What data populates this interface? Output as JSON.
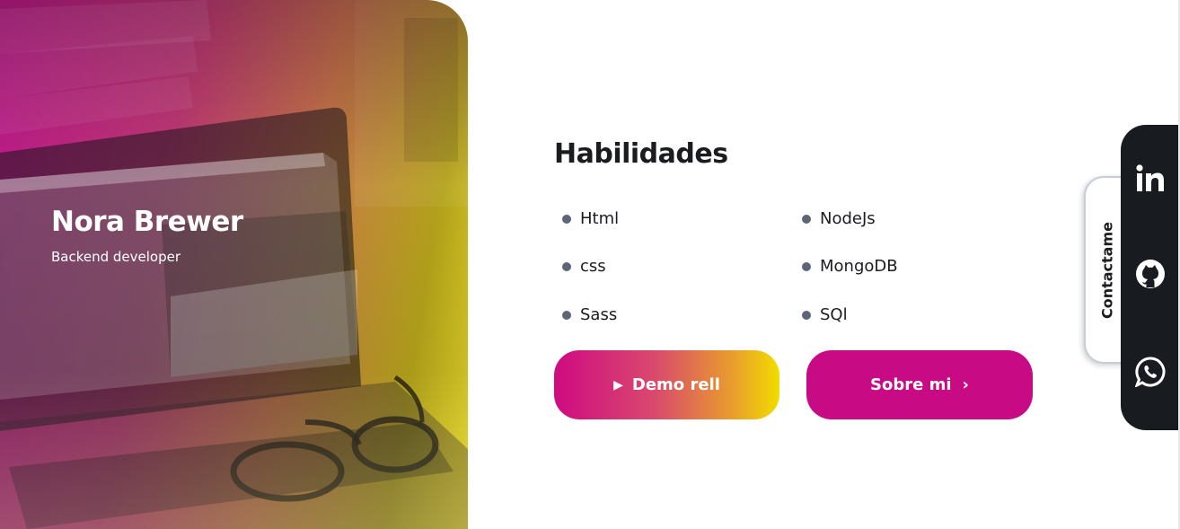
{
  "hero": {
    "name": "Nora Brewer",
    "role": "Backend developer"
  },
  "skills": {
    "title": "Habilidades",
    "left": [
      "Html",
      "css",
      "Sass"
    ],
    "right": [
      "NodeJs",
      "MongoDB",
      "SQl"
    ]
  },
  "buttons": {
    "demo_label": "Demo rell",
    "about_label": "Sobre mi"
  },
  "contact": {
    "tab_label": "Contactame",
    "icons": [
      "linkedin-icon",
      "github-icon",
      "whatsapp-icon"
    ]
  },
  "colors": {
    "accent_magenta": "#c80a84",
    "accent_yellow": "#f2dc00",
    "dark": "#181b1f",
    "bullet": "#5c6676"
  }
}
